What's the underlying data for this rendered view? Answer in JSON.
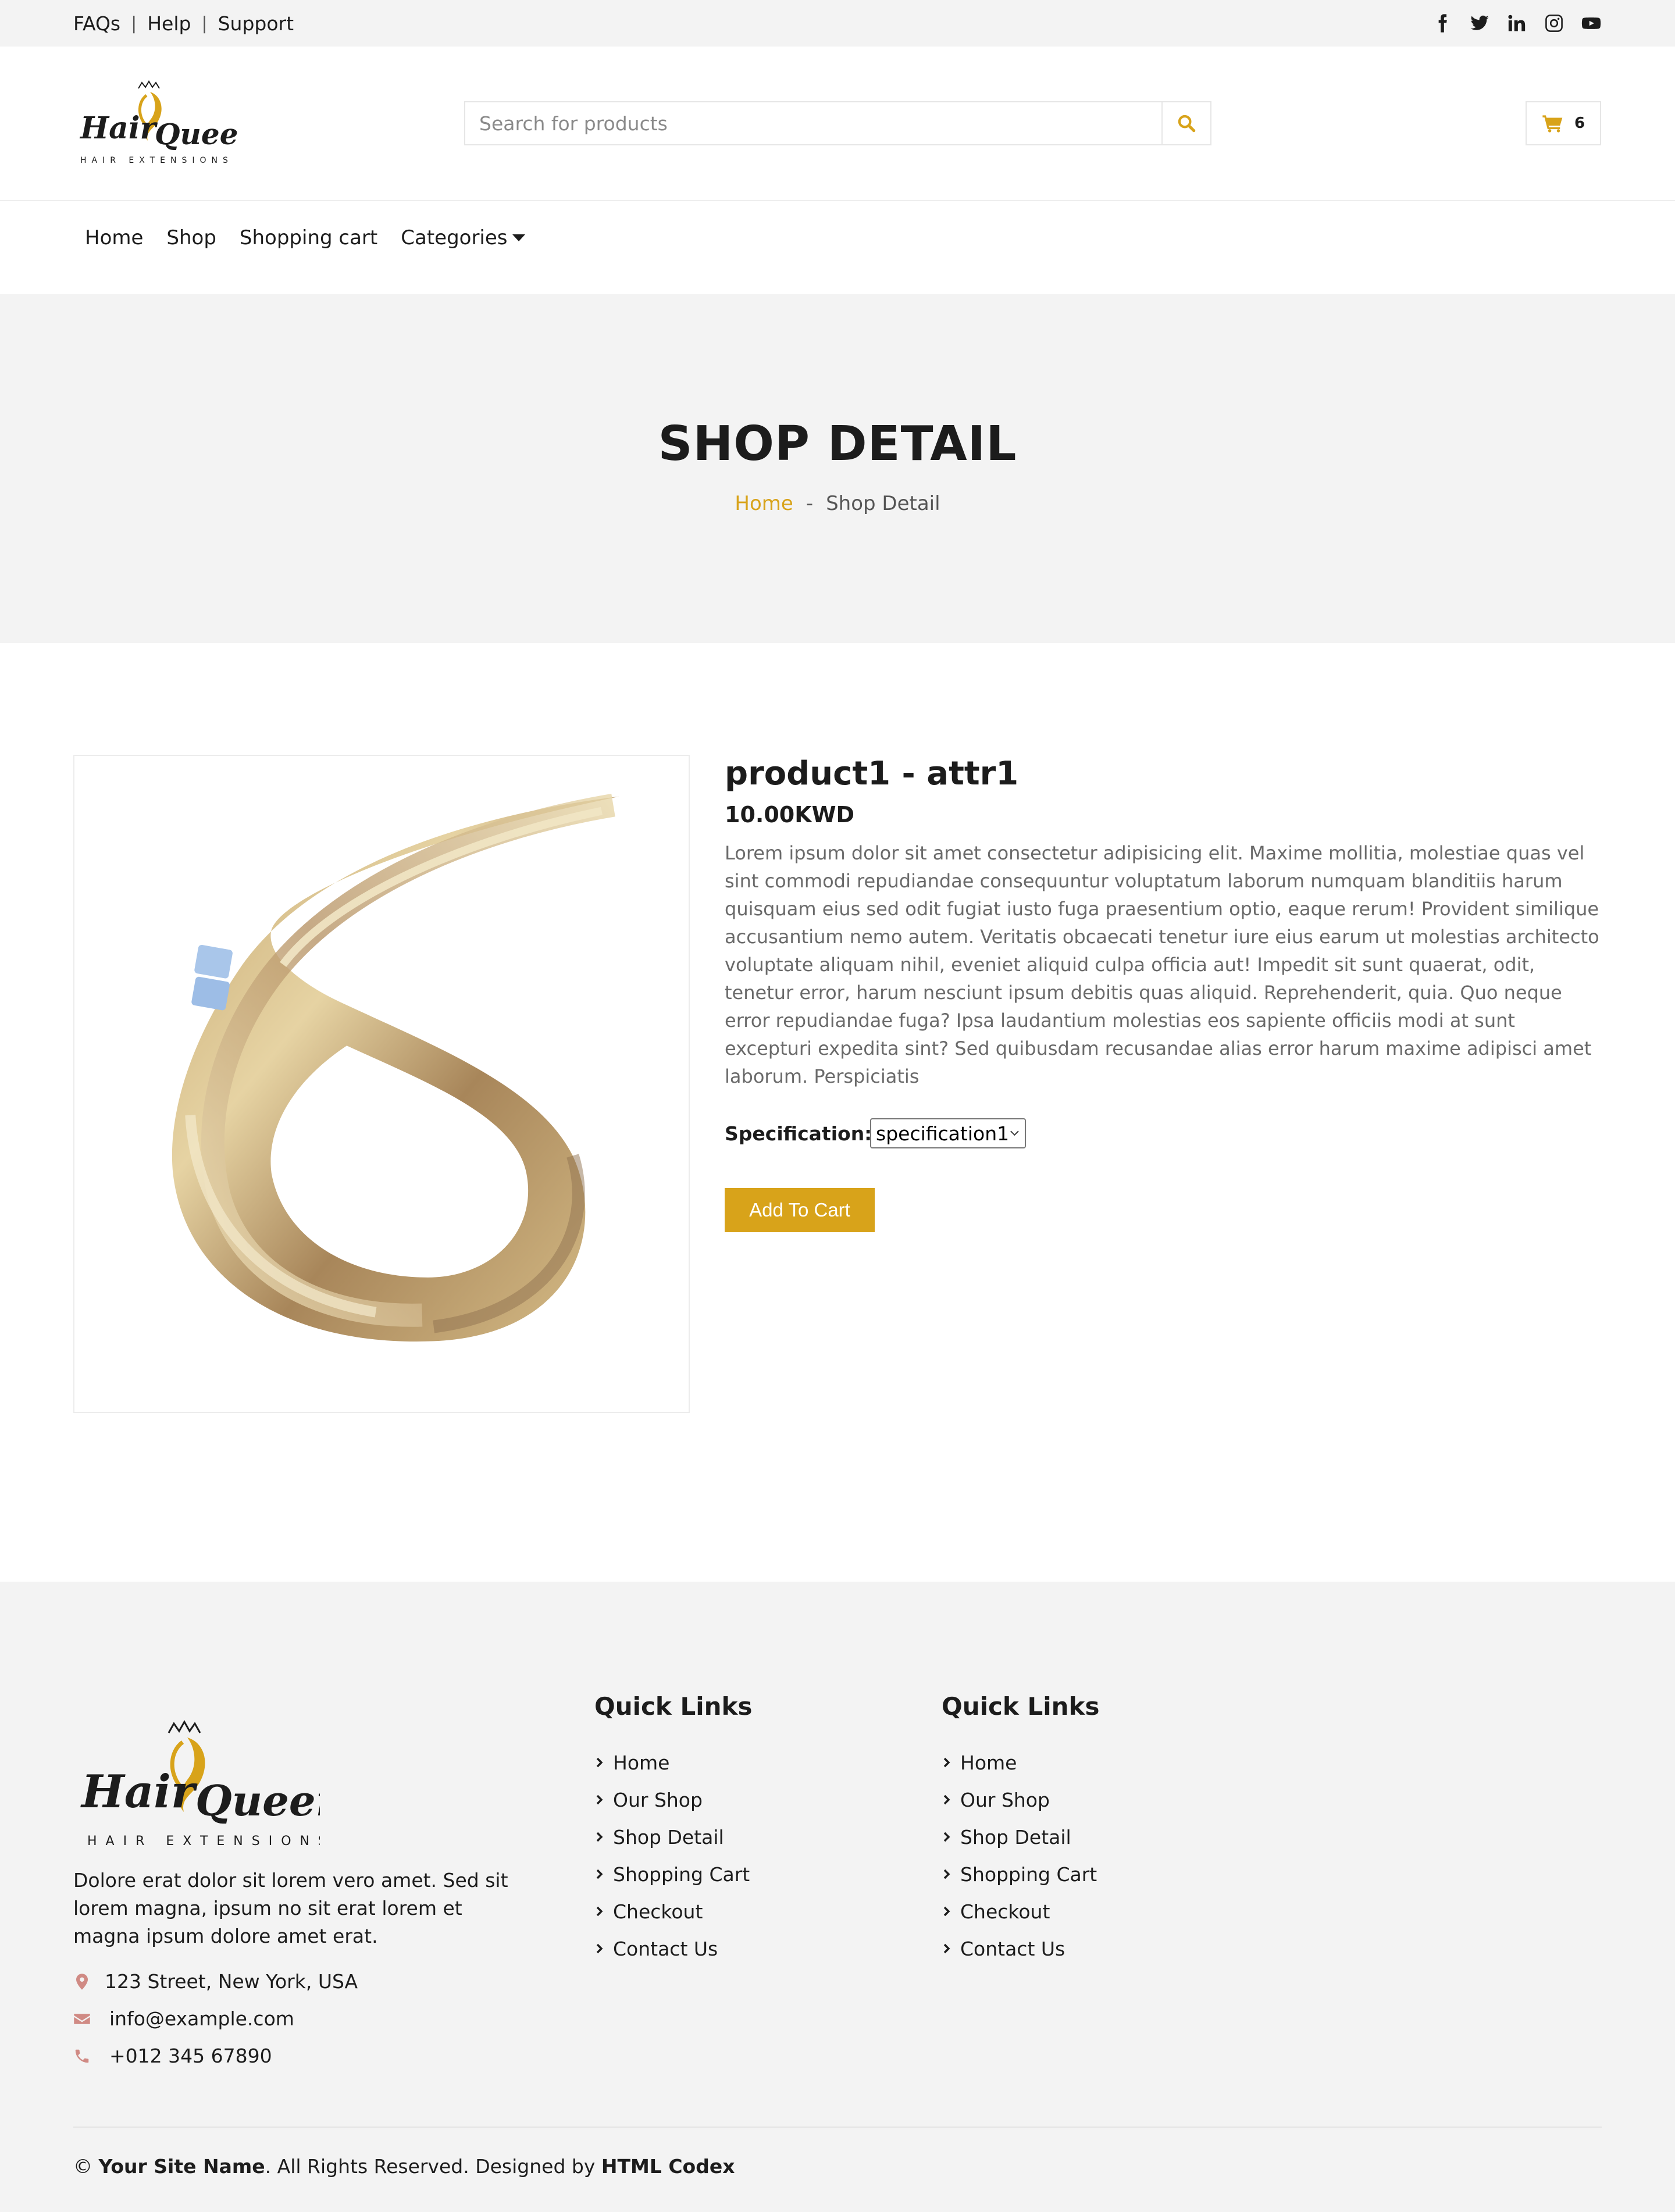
{
  "topbar": {
    "links": [
      "FAQs",
      "Help",
      "Support"
    ],
    "social_icons": [
      "facebook-icon",
      "twitter-icon",
      "linkedin-icon",
      "instagram-icon",
      "youtube-icon"
    ]
  },
  "header": {
    "logo": {
      "word1": "Hair",
      "word2": "Queen",
      "tagline": "HAIR EXTENSIONS"
    },
    "search_placeholder": "Search for products",
    "cart_count": "6"
  },
  "nav": {
    "items": [
      "Home",
      "Shop",
      "Shopping cart",
      "Categories"
    ]
  },
  "hero": {
    "title": "SHOP DETAIL",
    "breadcrumb_home": "Home",
    "breadcrumb_sep": "-",
    "breadcrumb_current": "Shop Detail"
  },
  "product": {
    "title": "product1 - attr1",
    "price": "10.00KWD",
    "description": "Lorem ipsum dolor sit amet consectetur adipisicing elit. Maxime mollitia, molestiae quas vel sint commodi repudiandae consequuntur voluptatum laborum numquam blanditiis harum quisquam eius sed odit fugiat iusto fuga praesentium optio, eaque rerum! Provident similique accusantium nemo autem. Veritatis obcaecati tenetur iure eius earum ut molestias architecto voluptate aliquam nihil, eveniet aliquid culpa officia aut! Impedit sit sunt quaerat, odit, tenetur error, harum nesciunt ipsum debitis quas aliquid. Reprehenderit, quia. Quo neque error repudiandae fuga? Ipsa laudantium molestias eos sapiente officiis modi at sunt excepturi expedita sint? Sed quibusdam recusandae alias error harum maxime adipisci amet laborum. Perspiciatis",
    "spec_label": "Specification:",
    "spec_value": "specification1",
    "add_to_cart": "Add To Cart"
  },
  "footer": {
    "about": "Dolore erat dolor sit lorem vero amet. Sed sit lorem magna, ipsum no sit erat lorem et magna ipsum dolore amet erat.",
    "address": "123 Street, New York, USA",
    "email": "info@example.com",
    "phone": "+012 345 67890",
    "quick_links_1": {
      "title": "Quick Links",
      "items": [
        "Home",
        "Our Shop",
        "Shop Detail",
        "Shopping Cart",
        "Checkout",
        "Contact Us"
      ]
    },
    "quick_links_2": {
      "title": "Quick Links",
      "items": [
        "Home",
        "Our Shop",
        "Shop Detail",
        "Shopping Cart",
        "Checkout",
        "Contact Us"
      ]
    },
    "copyright": {
      "prefix": "©",
      "site_name": "Your Site Name",
      "middle": ". All Rights Reserved. Designed by",
      "designer": "HTML Codex"
    }
  },
  "colors": {
    "accent": "#d8a31a",
    "background_gray": "#f3f3f3",
    "text": "#1c1c1c",
    "contact_icon": "#d08a84"
  }
}
